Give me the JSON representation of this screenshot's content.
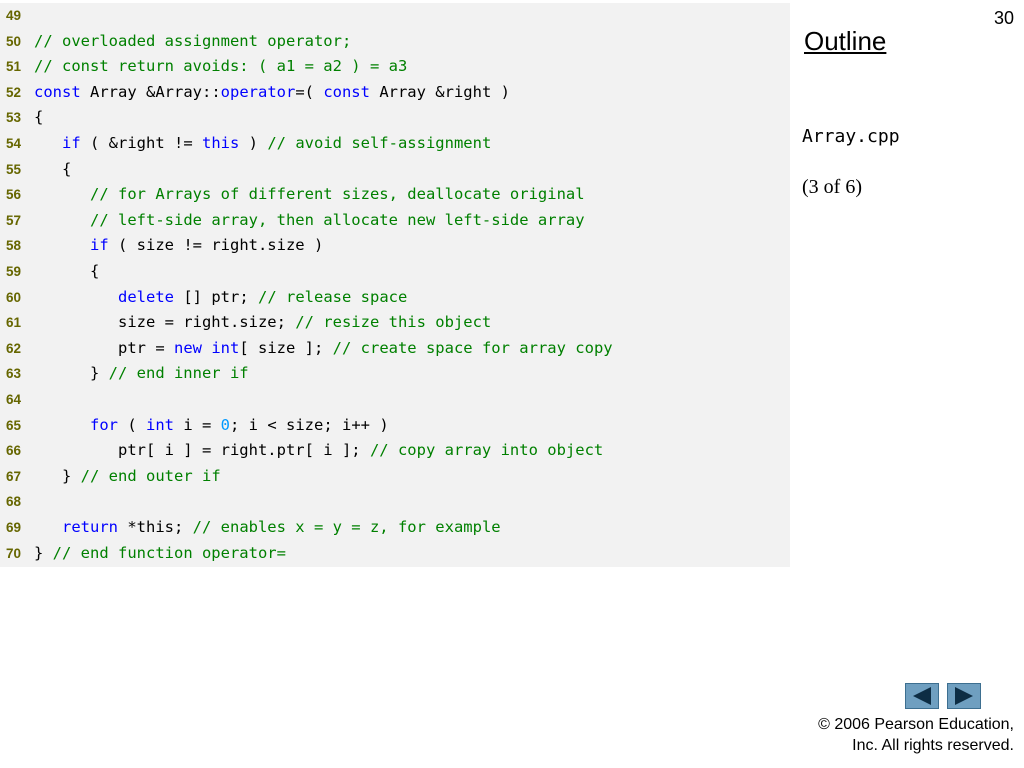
{
  "slide": {
    "number": "30",
    "outline_label": "Outline",
    "file_name": "Array.cpp",
    "page_part": "(3 of 6)",
    "copyright_line1": "© 2006 Pearson Education,",
    "copyright_line2": "Inc.  All rights reserved."
  },
  "nav": {
    "prev_icon": "triangle-left",
    "next_icon": "triangle-right"
  },
  "colors": {
    "keyword": "#0000ff",
    "comment": "#008000",
    "number": "#0099ff",
    "line_number": "#666600",
    "panel_bg": "#f2f2f2",
    "nav_button": "#6f9fc0"
  },
  "code_lines": [
    {
      "num": "49",
      "tokens": []
    },
    {
      "num": "50",
      "tokens": [
        [
          "cm",
          "// overloaded assignment operator;"
        ]
      ]
    },
    {
      "num": "51",
      "tokens": [
        [
          "cm",
          "// const return avoids: ( a1 = a2 ) = a3"
        ]
      ]
    },
    {
      "num": "52",
      "tokens": [
        [
          "kw",
          "const"
        ],
        [
          "",
          " Array &Array::"
        ],
        [
          "kw",
          "operator"
        ],
        [
          "",
          "=( "
        ],
        [
          "kw",
          "const"
        ],
        [
          "",
          " Array &right )"
        ]
      ]
    },
    {
      "num": "53",
      "tokens": [
        [
          "",
          "{"
        ]
      ]
    },
    {
      "num": "54",
      "tokens": [
        [
          "",
          "   "
        ],
        [
          "kw",
          "if"
        ],
        [
          "",
          " ( &right != "
        ],
        [
          "kw",
          "this"
        ],
        [
          "",
          " ) "
        ],
        [
          "cm",
          "// avoid self-assignment"
        ]
      ]
    },
    {
      "num": "55",
      "tokens": [
        [
          "",
          "   {"
        ]
      ]
    },
    {
      "num": "56",
      "tokens": [
        [
          "",
          "      "
        ],
        [
          "cm",
          "// for Arrays of different sizes, deallocate original"
        ]
      ]
    },
    {
      "num": "57",
      "tokens": [
        [
          "",
          "      "
        ],
        [
          "cm",
          "// left-side array, then allocate new left-side array"
        ]
      ]
    },
    {
      "num": "58",
      "tokens": [
        [
          "",
          "      "
        ],
        [
          "kw",
          "if"
        ],
        [
          "",
          " ( size != right.size )"
        ]
      ]
    },
    {
      "num": "59",
      "tokens": [
        [
          "",
          "      {"
        ]
      ]
    },
    {
      "num": "60",
      "tokens": [
        [
          "",
          "         "
        ],
        [
          "kw",
          "delete"
        ],
        [
          "",
          " [] ptr; "
        ],
        [
          "cm",
          "// release space"
        ]
      ]
    },
    {
      "num": "61",
      "tokens": [
        [
          "",
          "         size = right.size; "
        ],
        [
          "cm",
          "// resize this object"
        ]
      ]
    },
    {
      "num": "62",
      "tokens": [
        [
          "",
          "         ptr = "
        ],
        [
          "kw",
          "new"
        ],
        [
          "",
          " "
        ],
        [
          "kw",
          "int"
        ],
        [
          "",
          "[ size ]; "
        ],
        [
          "cm",
          "// create space for array copy"
        ]
      ]
    },
    {
      "num": "63",
      "tokens": [
        [
          "",
          "      } "
        ],
        [
          "cm",
          "// end inner if"
        ]
      ]
    },
    {
      "num": "64",
      "tokens": []
    },
    {
      "num": "65",
      "tokens": [
        [
          "",
          "      "
        ],
        [
          "kw",
          "for"
        ],
        [
          "",
          " ( "
        ],
        [
          "kw",
          "int"
        ],
        [
          "",
          " i = "
        ],
        [
          "num",
          "0"
        ],
        [
          "",
          "; i < size; i++ )"
        ]
      ]
    },
    {
      "num": "66",
      "tokens": [
        [
          "",
          "         ptr[ i ] = right.ptr[ i ]; "
        ],
        [
          "cm",
          "// copy array into object"
        ]
      ]
    },
    {
      "num": "67",
      "tokens": [
        [
          "",
          "   } "
        ],
        [
          "cm",
          "// end outer if"
        ]
      ]
    },
    {
      "num": "68",
      "tokens": []
    },
    {
      "num": "69",
      "tokens": [
        [
          "",
          "   "
        ],
        [
          "kw",
          "return"
        ],
        [
          "",
          " *this; "
        ],
        [
          "cm",
          "// enables x = y = z, for example"
        ]
      ]
    },
    {
      "num": "70",
      "tokens": [
        [
          "",
          "} "
        ],
        [
          "cm",
          "// end function operator="
        ]
      ]
    }
  ]
}
